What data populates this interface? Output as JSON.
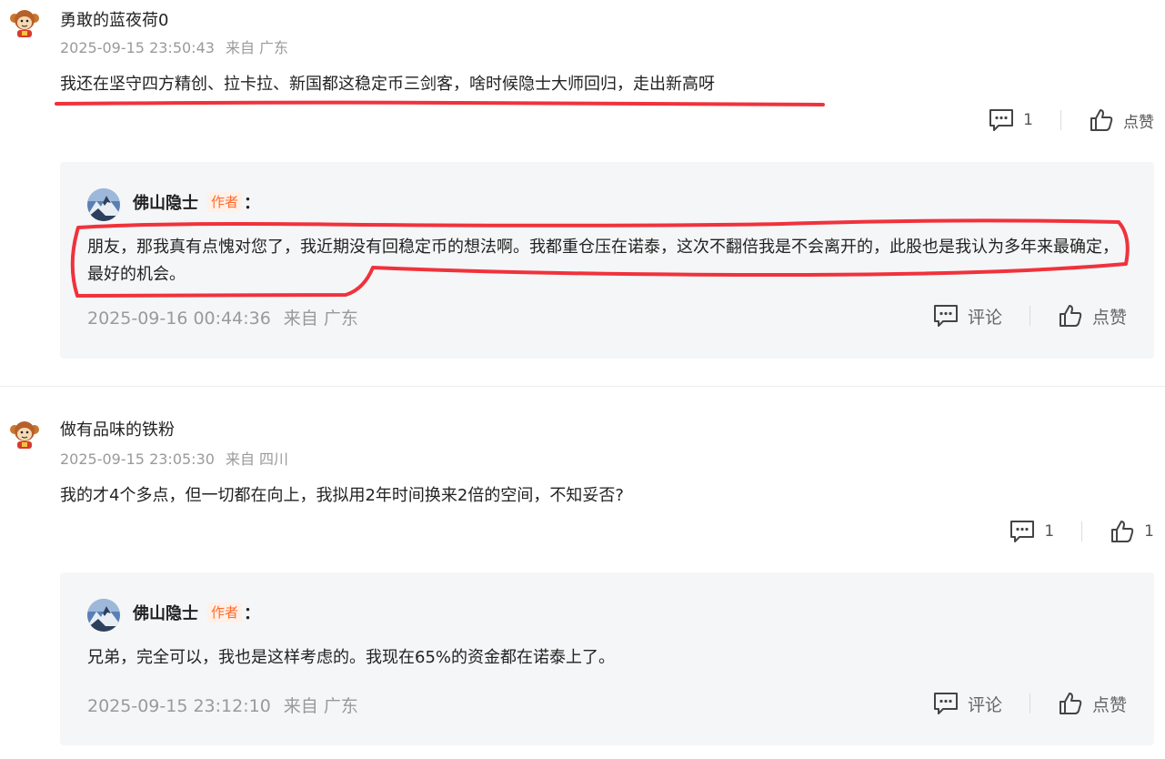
{
  "comments": [
    {
      "username": "勇敢的蓝夜荷0",
      "time": "2025-09-15 23:50:43",
      "location": "来自 广东",
      "text": "我还在坚守四方精创、拉卡拉、新国都这稳定币三剑客，啥时候隐士大师回归，走出新高呀",
      "comment_count": "1",
      "like_label": "点赞",
      "reply": {
        "author": "佛山隐士",
        "badge": "作者",
        "colon": "：",
        "text": "朋友，那我真有点愧对您了，我近期没有回稳定币的想法啊。我都重仓压在诺泰，这次不翻倍我是不会离开的，此股也是我认为多年来最确定，最好的机会。",
        "time": "2025-09-16 00:44:36",
        "location": "来自 广东",
        "comment_label": "评论",
        "like_label": "点赞"
      }
    },
    {
      "username": "做有品味的铁粉",
      "time": "2025-09-15 23:05:30",
      "location": "来自 四川",
      "text": "我的才4个多点，但一切都在向上，我拟用2年时间换来2倍的空间，不知妥否?",
      "comment_count": "1",
      "like_label": "1",
      "reply": {
        "author": "佛山隐士",
        "badge": "作者",
        "colon": "：",
        "text": "兄弟，完全可以，我也是这样考虑的。我现在65%的资金都在诺泰上了。",
        "time": "2025-09-15 23:12:10",
        "location": "来自 广东",
        "comment_label": "评论",
        "like_label": "点赞"
      }
    }
  ],
  "colors": {
    "annotation": "#f0323c",
    "badge": "#ff6a2a",
    "reply_bg": "#f5f6f7",
    "meta": "#9a9a9a"
  },
  "icons": {
    "comment": "comment-bubble-icon",
    "like": "thumbs-up-icon",
    "user_avatar": "monkey-avatar-icon",
    "author_avatar": "mountain-avatar-icon"
  }
}
